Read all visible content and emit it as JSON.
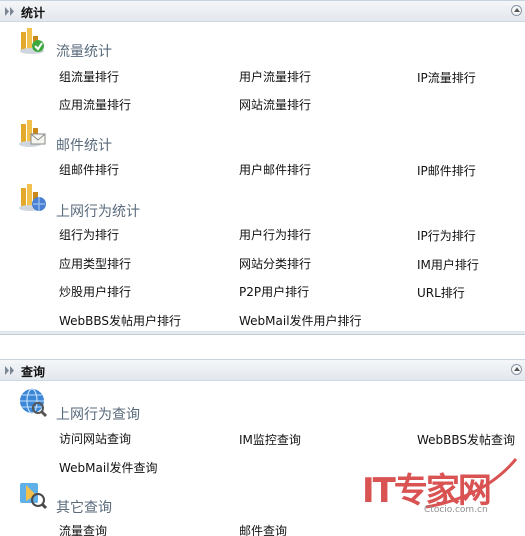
{
  "stats_panel": {
    "title": "统计",
    "groups": [
      {
        "icon": "traffic-stats-icon",
        "title": "流量统计",
        "rows": [
          [
            "组流量排行",
            "用户流量排行",
            "IP流量排行"
          ],
          [
            "应用流量排行",
            "网站流量排行"
          ]
        ]
      },
      {
        "icon": "mail-stats-icon",
        "title": "邮件统计",
        "rows": [
          [
            "组邮件排行",
            "用户邮件排行",
            "IP邮件排行"
          ]
        ]
      },
      {
        "icon": "behavior-stats-icon",
        "title": "上网行为统计",
        "rows": [
          [
            "组行为排行",
            "用户行为排行",
            "IP行为排行"
          ],
          [
            "应用类型排行",
            "网站分类排行",
            "IM用户排行"
          ],
          [
            "炒股用户排行",
            "P2P用户排行",
            "URL排行"
          ],
          [
            "WebBBS发帖用户排行",
            "WebMail发件用户排行"
          ]
        ]
      }
    ]
  },
  "query_panel": {
    "title": "查询",
    "groups": [
      {
        "icon": "globe-query-icon",
        "title": "上网行为查询",
        "rows": [
          [
            "访问网站查询",
            "IM监控查询",
            "WebBBS发帖查询"
          ],
          [
            "WebMail发件查询"
          ]
        ]
      },
      {
        "icon": "other-query-icon",
        "title": "其它查询",
        "rows": [
          [
            "流量查询",
            "邮件查询"
          ]
        ]
      }
    ]
  },
  "watermark": {
    "brand": "IT专家网",
    "site": "Ctocio.com.cn"
  },
  "colors": {
    "header_bg": "#e3e8ee",
    "group_title": "#5a6b7c",
    "watermark": "#d84a4a"
  }
}
